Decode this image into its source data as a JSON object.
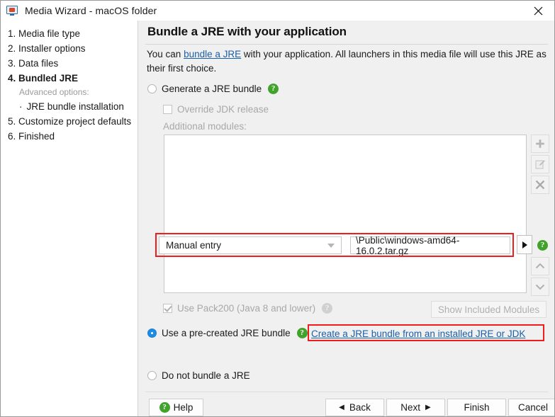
{
  "window": {
    "title": "Media Wizard - macOS folder",
    "icon": "monitor-icon",
    "close_label": "✕"
  },
  "sidebar": {
    "items": [
      {
        "label": "1. Media file type",
        "current": false
      },
      {
        "label": "2. Installer options",
        "current": false
      },
      {
        "label": "3. Data files",
        "current": false
      },
      {
        "label": "4. Bundled JRE",
        "current": true
      }
    ],
    "advanced_label": "Advanced options:",
    "sub_items": [
      {
        "bullet": "·",
        "label": "JRE bundle installation"
      }
    ],
    "items_after": [
      {
        "label": "5. Customize project defaults",
        "current": false
      },
      {
        "label": "6. Finished",
        "current": false
      }
    ]
  },
  "main": {
    "title": "Bundle a JRE with your application",
    "intro": {
      "before": "You can ",
      "link": "bundle a JRE",
      "after": " with your application. All launchers in this media file will use this JRE as their first choice."
    },
    "generate_radio": {
      "label": "Generate a JRE bundle",
      "checked": false,
      "help": "?"
    },
    "override_checkbox": {
      "label": "Override JDK release",
      "checked": false,
      "enabled": false
    },
    "additional_modules_label": "Additional modules:",
    "list_buttons": [
      {
        "name": "add-module-button",
        "icon": "plus-icon"
      },
      {
        "name": "edit-module-button",
        "icon": "edit-icon"
      },
      {
        "name": "delete-module-button",
        "icon": "close-x-icon"
      },
      {
        "name": "move-up-button",
        "icon": "chevron-up-icon"
      },
      {
        "name": "move-down-button",
        "icon": "chevron-down-icon"
      }
    ],
    "pack200_checkbox": {
      "label": "Use Pack200 (Java 8 and lower)",
      "checked": true,
      "enabled": false,
      "help": "?"
    },
    "show_modules_button": {
      "label": "Show Included Modules",
      "enabled": false
    },
    "precreated_radio": {
      "label": "Use a pre-created JRE bundle",
      "checked": true,
      "help": "?"
    },
    "create_bundle_link": "Create a JRE bundle from an installed JRE or JDK",
    "jre_source_dropdown": {
      "value": "Manual entry"
    },
    "jre_path_field": {
      "value": "\\Public\\windows-amd64-16.0.2.tar.gz"
    },
    "browse_button": {
      "icon": "triangle-right-icon"
    },
    "path_help": "?",
    "no_bundle_radio": {
      "label": "Do not bundle a JRE",
      "checked": false
    }
  },
  "footer": {
    "help": {
      "label": "Help",
      "icon": "?"
    },
    "back": {
      "label": "Back",
      "icon": "◀"
    },
    "next": {
      "label": "Next",
      "icon": "▶"
    },
    "finish": {
      "label": "Finish"
    },
    "cancel": {
      "label": "Cancel"
    }
  },
  "colors": {
    "accent_blue": "#1e8ce0",
    "link_blue": "#1c5fa8",
    "help_green": "#42a32c",
    "annotation_red": "#ef1d1d",
    "panel_bg": "#f0f0f0"
  }
}
